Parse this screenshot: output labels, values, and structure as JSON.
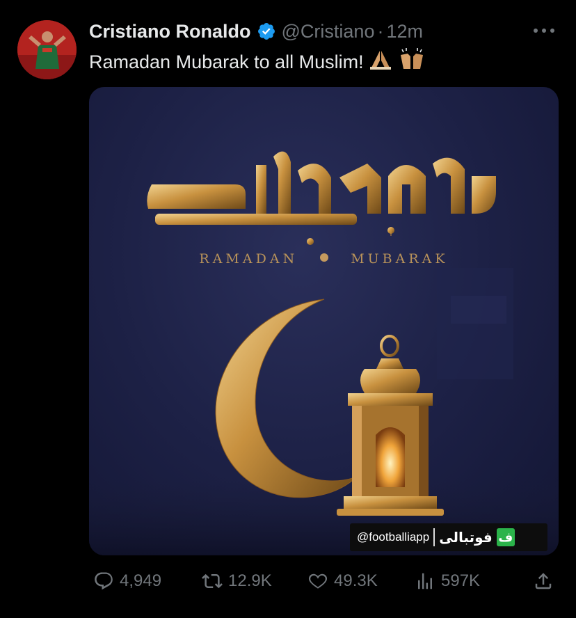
{
  "tweet": {
    "author_name": "Cristiano Ronaldo",
    "handle": "@Cristiano",
    "separator": "·",
    "time": "12m",
    "text": "Ramadan Mubarak to all Muslim!",
    "emojis": [
      "folded-hands-emoji",
      "raising-hands-emoji"
    ]
  },
  "media": {
    "subtitle_left": "RAMADAN",
    "subtitle_right": "MUBARAK",
    "calligraphy_text": "رمضان مبارک",
    "watermark_handle": "@footballiapp",
    "watermark_brand": "فوتبالی",
    "watermark_logo": "ف"
  },
  "actions": {
    "replies": "4,949",
    "retweets": "12.9K",
    "likes": "49.3K",
    "views": "597K"
  },
  "icons": [
    "verified-icon",
    "more-icon",
    "reply-icon",
    "retweet-icon",
    "like-icon",
    "views-icon",
    "share-icon"
  ],
  "colors": {
    "background": "#000000",
    "text": "#e7e9ea",
    "muted": "#71767b",
    "verified": "#1d9bf0",
    "gold": "#c59a5e",
    "media_bg": "#1d2146"
  }
}
